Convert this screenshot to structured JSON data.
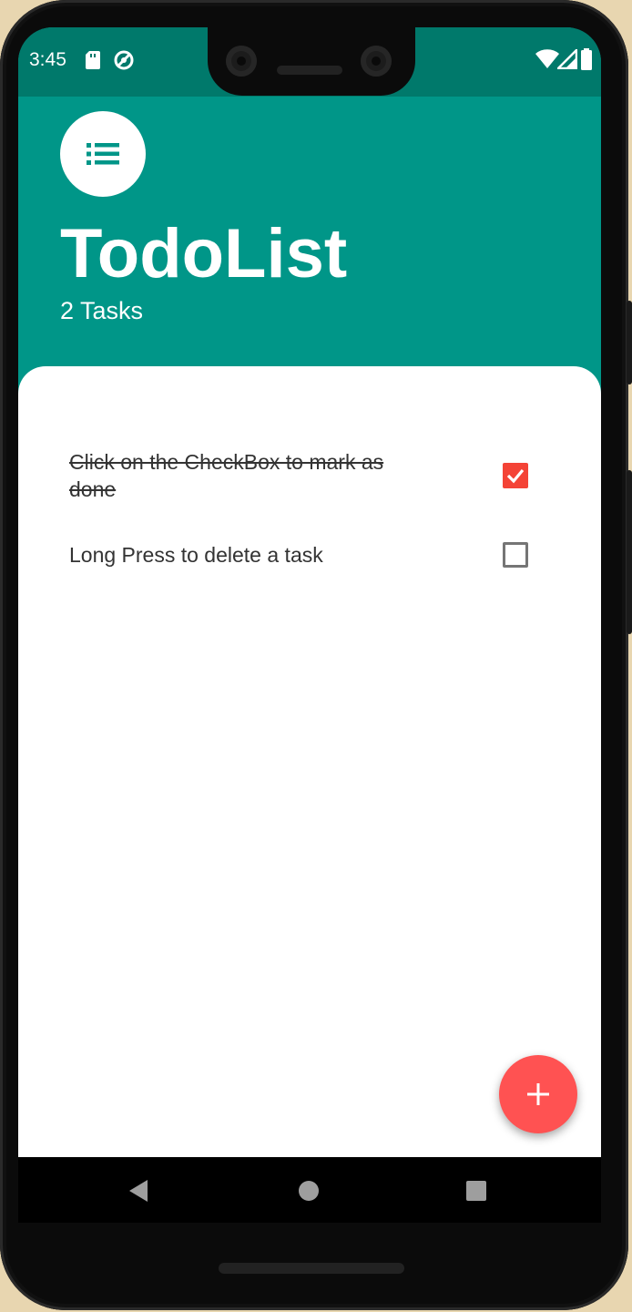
{
  "status_bar": {
    "time": "3:45",
    "icons": [
      "sd-card-icon",
      "sync-icon",
      "wifi-icon",
      "cell-signal-icon",
      "battery-icon"
    ]
  },
  "header": {
    "icon": "list-icon",
    "title": "TodoList",
    "subtitle": "2 Tasks"
  },
  "tasks": [
    {
      "text": "Click on the CheckBox to mark as done",
      "checked": true
    },
    {
      "text": "Long Press to delete a task",
      "checked": false
    }
  ],
  "fab": {
    "icon": "plus-icon"
  },
  "nav_bar": {
    "icons": [
      "back-icon",
      "home-icon",
      "recents-icon"
    ]
  },
  "colors": {
    "primary": "#009688",
    "primary_dark": "#00796b",
    "accent": "#ff5252",
    "checkbox_checked": "#f44336"
  }
}
